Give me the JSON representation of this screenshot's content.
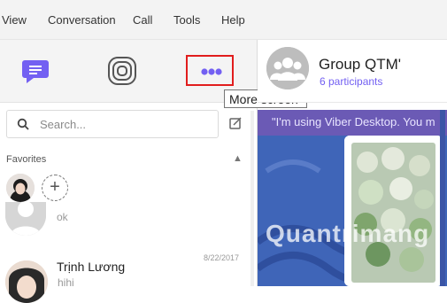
{
  "menu": {
    "items": [
      "View",
      "Conversation",
      "Call",
      "Tools",
      "Help"
    ]
  },
  "toolbar": {
    "chats_icon": "chat-bubble-icon",
    "stories_icon": "stories-icon",
    "more_icon": "more-dots-icon"
  },
  "tooltip": {
    "text": "More screen"
  },
  "search": {
    "placeholder": "Search..."
  },
  "favorites": {
    "label": "Favorites"
  },
  "conversations": [
    {
      "name": "",
      "message": "ok",
      "date": ""
    },
    {
      "name": "Trịnh Lương",
      "message": "hihi",
      "date": "8/22/2017"
    }
  ],
  "chat": {
    "title": "Group QTM'",
    "subtitle": "6 participants",
    "status": "\"I'm using Viber Desktop. You m"
  },
  "watermark": {
    "text": "Quantrimang"
  },
  "colors": {
    "accent": "#7360f2",
    "highlight": "#e11d1d",
    "status_bar": "#6b5ab5",
    "chat_bg": "#3f65b8"
  }
}
